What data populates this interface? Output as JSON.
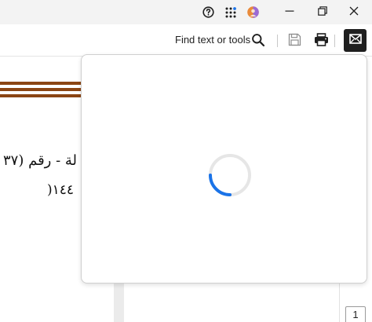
{
  "toolbar": {
    "find_label": "Find text or tools"
  },
  "document": {
    "line1": "لة - رقم (٣٧",
    "line2": ")١٤٤"
  },
  "page_indicator": {
    "value": "1"
  },
  "icons": {
    "help": "help-icon",
    "apps": "apps-grid-icon",
    "avatar": "profile-avatar-icon",
    "minimize": "minimize-icon",
    "restore": "restore-icon",
    "close": "close-icon",
    "search": "search-icon",
    "save": "save-icon",
    "print": "print-icon",
    "mail": "mail-icon",
    "loading": "loading-spinner-icon"
  },
  "colors": {
    "accent_blue": "#1a73e8",
    "rule_brown": "#8b4513",
    "active_button_bg": "#1f1f1f"
  }
}
